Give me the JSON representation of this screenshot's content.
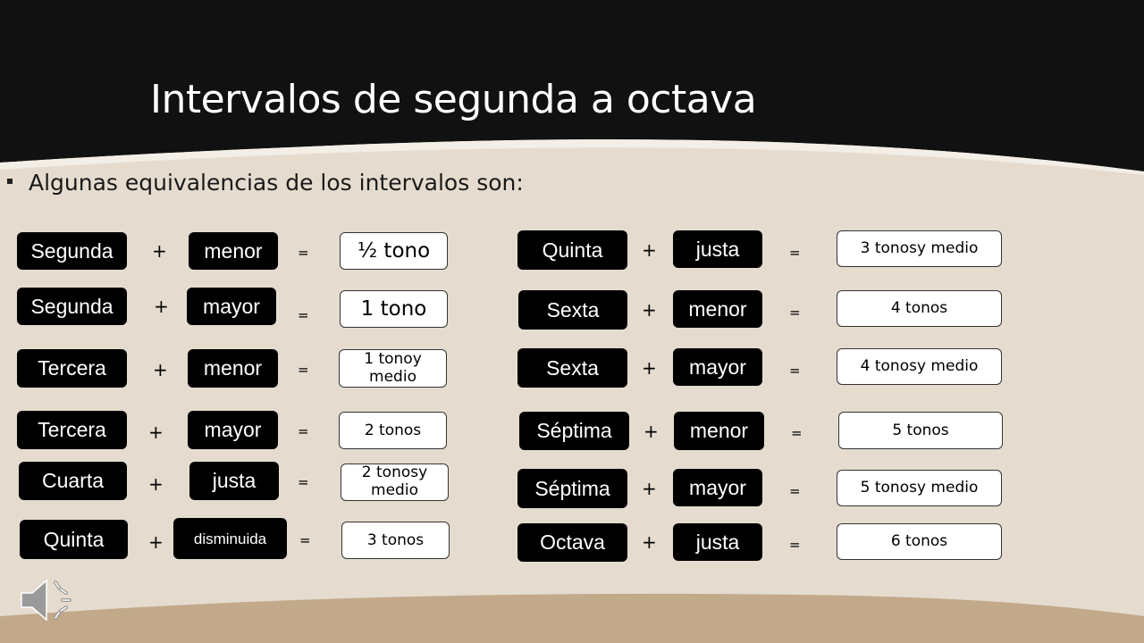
{
  "slide": {
    "title": "Intervalos de segunda a octava",
    "bullet": "Algunas equivalencias de los intervalos son:",
    "operators": {
      "plus": "+",
      "equals": "="
    },
    "colors": {
      "header": "#111111",
      "background": "#e5dccf",
      "footer": "#c2a98a",
      "box_dark": "#000000",
      "box_light": "#ffffff"
    },
    "audio_icon": "speaker-icon"
  },
  "left": [
    {
      "interval": "Segunda",
      "quality": "menor",
      "result": "½ tono"
    },
    {
      "interval": "Segunda",
      "quality": "mayor",
      "result": "1 tono"
    },
    {
      "interval": "Tercera",
      "quality": "menor",
      "result": "1 tonoy medio"
    },
    {
      "interval": "Tercera",
      "quality": "mayor",
      "result": "2 tonos"
    },
    {
      "interval": "Cuarta",
      "quality": "justa",
      "result": "2 tonosy medio"
    },
    {
      "interval": "Quinta",
      "quality": "disminuida",
      "result": "3 tonos"
    }
  ],
  "right": [
    {
      "interval": "Quinta",
      "quality": "justa",
      "result": "3 tonosy medio"
    },
    {
      "interval": "Sexta",
      "quality": "menor",
      "result": "4 tonos"
    },
    {
      "interval": "Sexta",
      "quality": "mayor",
      "result": "4 tonosy medio"
    },
    {
      "interval": "Séptima",
      "quality": "menor",
      "result": "5 tonos"
    },
    {
      "interval": "Séptima",
      "quality": "mayor",
      "result": "5 tonosy medio"
    },
    {
      "interval": "Octava",
      "quality": "justa",
      "result": "6 tonos"
    }
  ]
}
